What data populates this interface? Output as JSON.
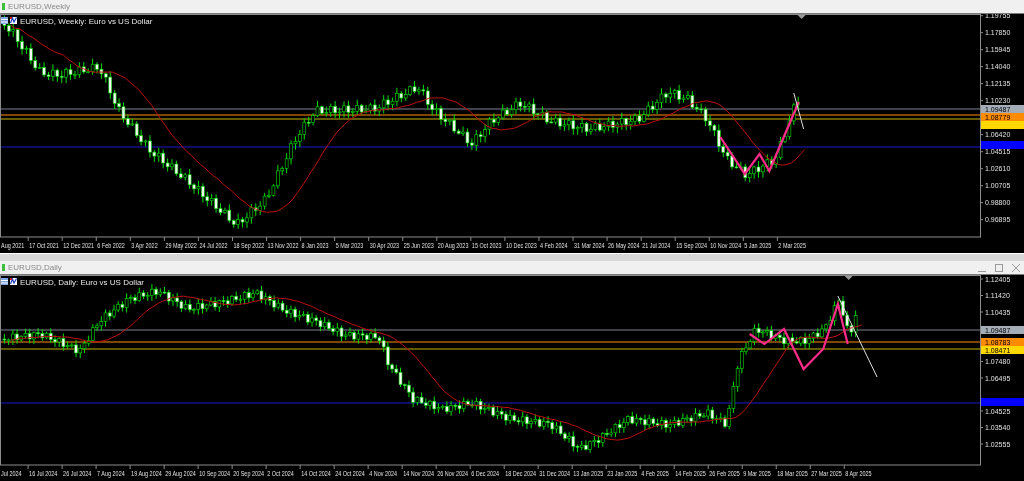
{
  "windows": [
    {
      "title": "EURUSD,Weekly",
      "chart_label": "EURUSD, Weekly:  Euro vs US Dollar",
      "y_ticks": [
        "1.19755",
        "1.17850",
        "1.15945",
        "1.14040",
        "1.12135",
        "1.10230",
        "1.06420",
        "1.04515",
        "1.02610",
        "1.00705",
        "0.98800",
        "0.96895"
      ],
      "price_tags": [
        {
          "label": "1.09487",
          "color": "#a4acb8"
        },
        {
          "label": "1.08779",
          "color": "#ff8c00"
        },
        {
          "color": "#ffd800"
        },
        {
          "color": "#0000ff"
        }
      ],
      "x_ticks": [
        "Aug 2021",
        "17 Oct 2021",
        "12 Dec 2021",
        "6 Feb 2022",
        "3 Apr 2022",
        "29 May 2022",
        "24 Jul 2022",
        "18 Sep 2022",
        "13 Nov 2022",
        "8 Jan 2023",
        "5 Mar 2023",
        "30 Apr 2023",
        "25 Jun 2023",
        "20 Aug 2023",
        "15 Oct 2023",
        "10 Dec 2023",
        "4 Feb 2024",
        "31 Mar 2024",
        "26 May 2024",
        "21 Jul 2024",
        "15 Sep 2024",
        "10 Nov 2024",
        "5 Jan 2025",
        "2 Mar 2025"
      ]
    },
    {
      "title": "EURUSD,Daily",
      "chart_label": "EURUSD, Daily:  Euro vs US Dollar",
      "window_buttons": [
        {
          "kind": "minimize"
        },
        {
          "kind": "maximize"
        },
        {
          "kind": "close"
        }
      ],
      "y_ticks": [
        "1.12405",
        "1.11420",
        "1.10435",
        "1.07480",
        "1.06495",
        "1.04525",
        "1.03540",
        "1.02555"
      ],
      "price_tags": [
        {
          "label": "1.09487",
          "color": "#a4acb8"
        },
        {
          "label": "1.08783",
          "color": "#ff8c00"
        },
        {
          "label": "1.08471",
          "color": "#ffd800"
        },
        {
          "color": "#0000ff"
        }
      ],
      "x_ticks": [
        "Jul 2024",
        "16 Jul 2024",
        "26 Jul 2024",
        "7 Aug 2024",
        "19 Aug 2024",
        "29 Aug 2024",
        "10 Sep 2024",
        "20 Sep 2024",
        "2 Oct 2024",
        "14 Oct 2024",
        "24 Oct 2024",
        "4 Nov 2024",
        "14 Nov 2024",
        "26 Nov 2024",
        "6 Dec 2024",
        "18 Dec 2024",
        "31 Dec 2024",
        "13 Jan 2025",
        "23 Jan 2025",
        "4 Feb 2025",
        "14 Feb 2025",
        "26 Feb 2025",
        "9 Mar 2025",
        "18 Mar 2025",
        "27 Mar 2025",
        "8 Apr 2025"
      ]
    }
  ]
}
